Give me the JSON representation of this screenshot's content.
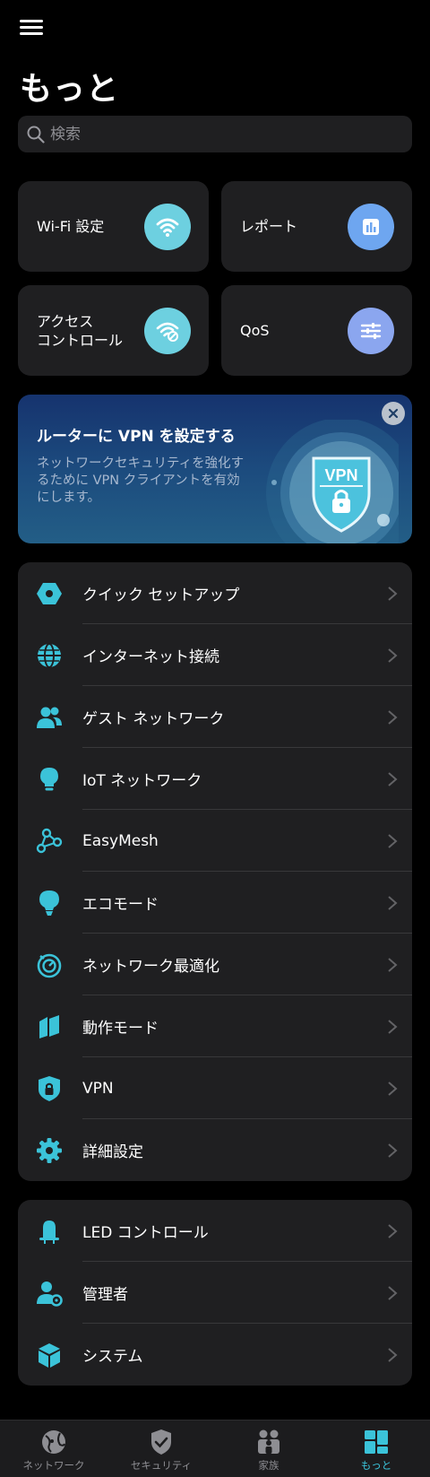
{
  "header": {
    "menu_icon": "hamburger-menu-icon",
    "title": "もっと"
  },
  "search": {
    "placeholder": "検索",
    "value": ""
  },
  "tiles": [
    {
      "label": "Wi-Fi 設定",
      "icon": "wifi-icon",
      "color": "#6dd0e0"
    },
    {
      "label": "レポート",
      "icon": "bar-chart-icon",
      "color": "#6ea6f0"
    },
    {
      "label": "アクセス\nコントロール",
      "icon": "wifi-blocked-icon",
      "color": "#6dd0e0"
    },
    {
      "label": "QoS",
      "icon": "sliders-icon",
      "color": "#8ba6ef"
    }
  ],
  "banner": {
    "title": "ルーターに VPN を設定する",
    "description": "ネットワークセキュリティを強化するために VPN クライアントを有効にします。",
    "badge_text": "VPN",
    "close_icon": "close-icon"
  },
  "main_list": [
    {
      "label": "クイック セットアップ",
      "icon": "hexagon-nut-icon"
    },
    {
      "label": "インターネット接続",
      "icon": "globe-icon"
    },
    {
      "label": "ゲスト ネットワーク",
      "icon": "guests-icon"
    },
    {
      "label": "IoT ネットワーク",
      "icon": "lightbulb-icon"
    },
    {
      "label": "EasyMesh",
      "icon": "mesh-nodes-icon"
    },
    {
      "label": "エコモード",
      "icon": "eco-bulb-icon"
    },
    {
      "label": "ネットワーク最適化",
      "icon": "optimize-timer-icon"
    },
    {
      "label": "動作モード",
      "icon": "map-mode-icon"
    },
    {
      "label": "VPN",
      "icon": "shield-lock-icon"
    },
    {
      "label": "詳細設定",
      "icon": "gear-icon"
    }
  ],
  "secondary_list": [
    {
      "label": "LED コントロール",
      "icon": "bell-led-icon"
    },
    {
      "label": "管理者",
      "icon": "admin-user-icon"
    },
    {
      "label": "システム",
      "icon": "cube-icon"
    }
  ],
  "tabbar": [
    {
      "label": "ネットワーク",
      "icon": "network-globe-icon",
      "active": false
    },
    {
      "label": "セキュリティ",
      "icon": "security-shield-icon",
      "active": false
    },
    {
      "label": "家族",
      "icon": "family-icon",
      "active": false
    },
    {
      "label": "もっと",
      "icon": "more-grid-icon",
      "active": true
    }
  ],
  "colors": {
    "accent": "#3bc3d9",
    "background": "#000000",
    "card": "#1f1f21",
    "divider": "#38383a",
    "inactive_tab": "#8e8e93"
  }
}
